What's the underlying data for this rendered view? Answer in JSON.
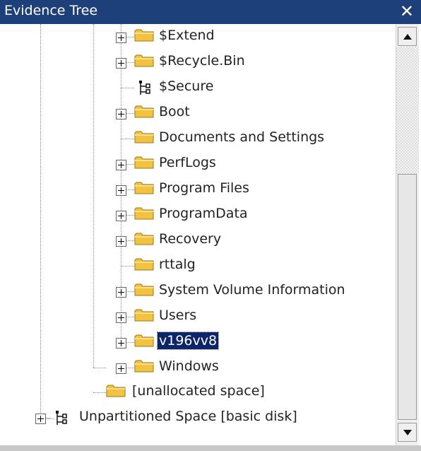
{
  "window": {
    "title": "Evidence Tree",
    "close_glyph": "✕"
  },
  "tree": {
    "items": [
      {
        "label": "$Extend",
        "icon": "folder-icon",
        "expandable": true,
        "selected": false
      },
      {
        "label": "$Recycle.Bin",
        "icon": "folder-icon",
        "expandable": true,
        "selected": false
      },
      {
        "label": "$Secure",
        "icon": "tree-node-icon",
        "expandable": false,
        "selected": false
      },
      {
        "label": "Boot",
        "icon": "folder-icon",
        "expandable": true,
        "selected": false
      },
      {
        "label": "Documents and Settings",
        "icon": "folder-icon",
        "expandable": false,
        "selected": false
      },
      {
        "label": "PerfLogs",
        "icon": "folder-icon",
        "expandable": true,
        "selected": false
      },
      {
        "label": "Program Files",
        "icon": "folder-icon",
        "expandable": true,
        "selected": false
      },
      {
        "label": "ProgramData",
        "icon": "folder-icon",
        "expandable": true,
        "selected": false
      },
      {
        "label": "Recovery",
        "icon": "folder-icon",
        "expandable": true,
        "selected": false
      },
      {
        "label": "rttalg",
        "icon": "folder-icon",
        "expandable": false,
        "selected": false
      },
      {
        "label": "System Volume Information",
        "icon": "folder-icon",
        "expandable": true,
        "selected": false
      },
      {
        "label": "Users",
        "icon": "folder-icon",
        "expandable": true,
        "selected": false
      },
      {
        "label": "v196vv8",
        "icon": "folder-icon",
        "expandable": true,
        "selected": true
      },
      {
        "label": "Windows",
        "icon": "folder-icon",
        "expandable": true,
        "selected": false
      }
    ],
    "unallocated": {
      "label": "[unallocated space]",
      "icon": "folder-icon"
    },
    "unpartitioned": {
      "label": "Unpartitioned Space [basic disk]",
      "icon": "tree-node-icon",
      "expandable": true
    }
  },
  "scrollbar": {
    "up_icon": "arrow-up-icon",
    "down_icon": "arrow-down-icon"
  },
  "colors": {
    "titlebar": "#1d3f7a",
    "selection": "#0b246a",
    "folder": "#f5c542"
  }
}
